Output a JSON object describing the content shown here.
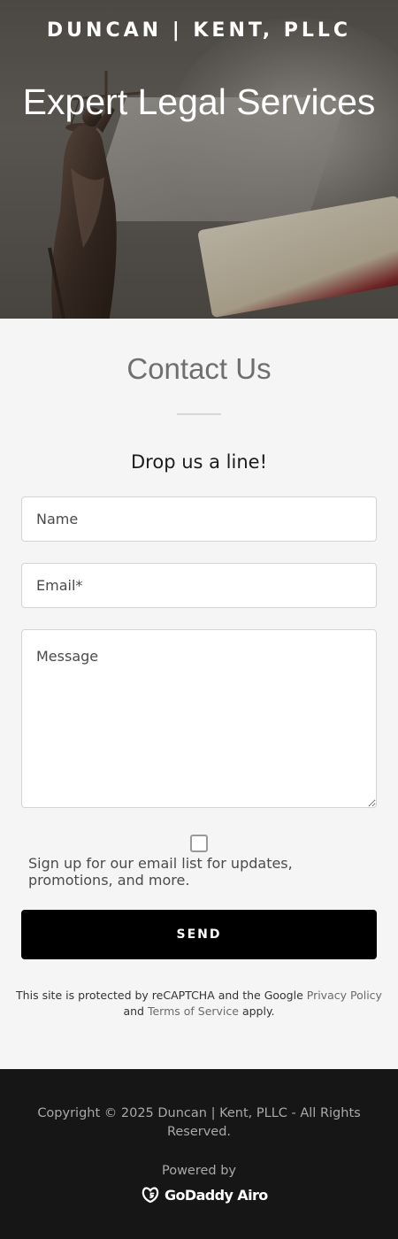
{
  "hero": {
    "brand": "DUNCAN | KENT, PLLC",
    "title": "Expert Legal Services"
  },
  "contact": {
    "title": "Contact Us",
    "subtitle": "Drop us a line!",
    "name_placeholder": "Name",
    "email_placeholder": "Email*",
    "message_placeholder": "Message",
    "signup_label": "Sign up for our email list for updates, promotions, and more.",
    "send_label": "SEND",
    "recaptcha": {
      "prefix": "This site is protected by reCAPTCHA and the Google ",
      "privacy_link": "Privacy Policy",
      "middle": " and ",
      "terms_link": "Terms of Service",
      "suffix": " apply."
    }
  },
  "footer": {
    "copyright": "Copyright © 2025 Duncan | Kent, PLLC - All Rights Reserved.",
    "powered_by": "Powered by",
    "logo_text": "GoDaddy Airo"
  },
  "colors": {
    "footer_bg": "#161616",
    "button_bg": "#000000",
    "page_bg": "#f5f5f5"
  }
}
